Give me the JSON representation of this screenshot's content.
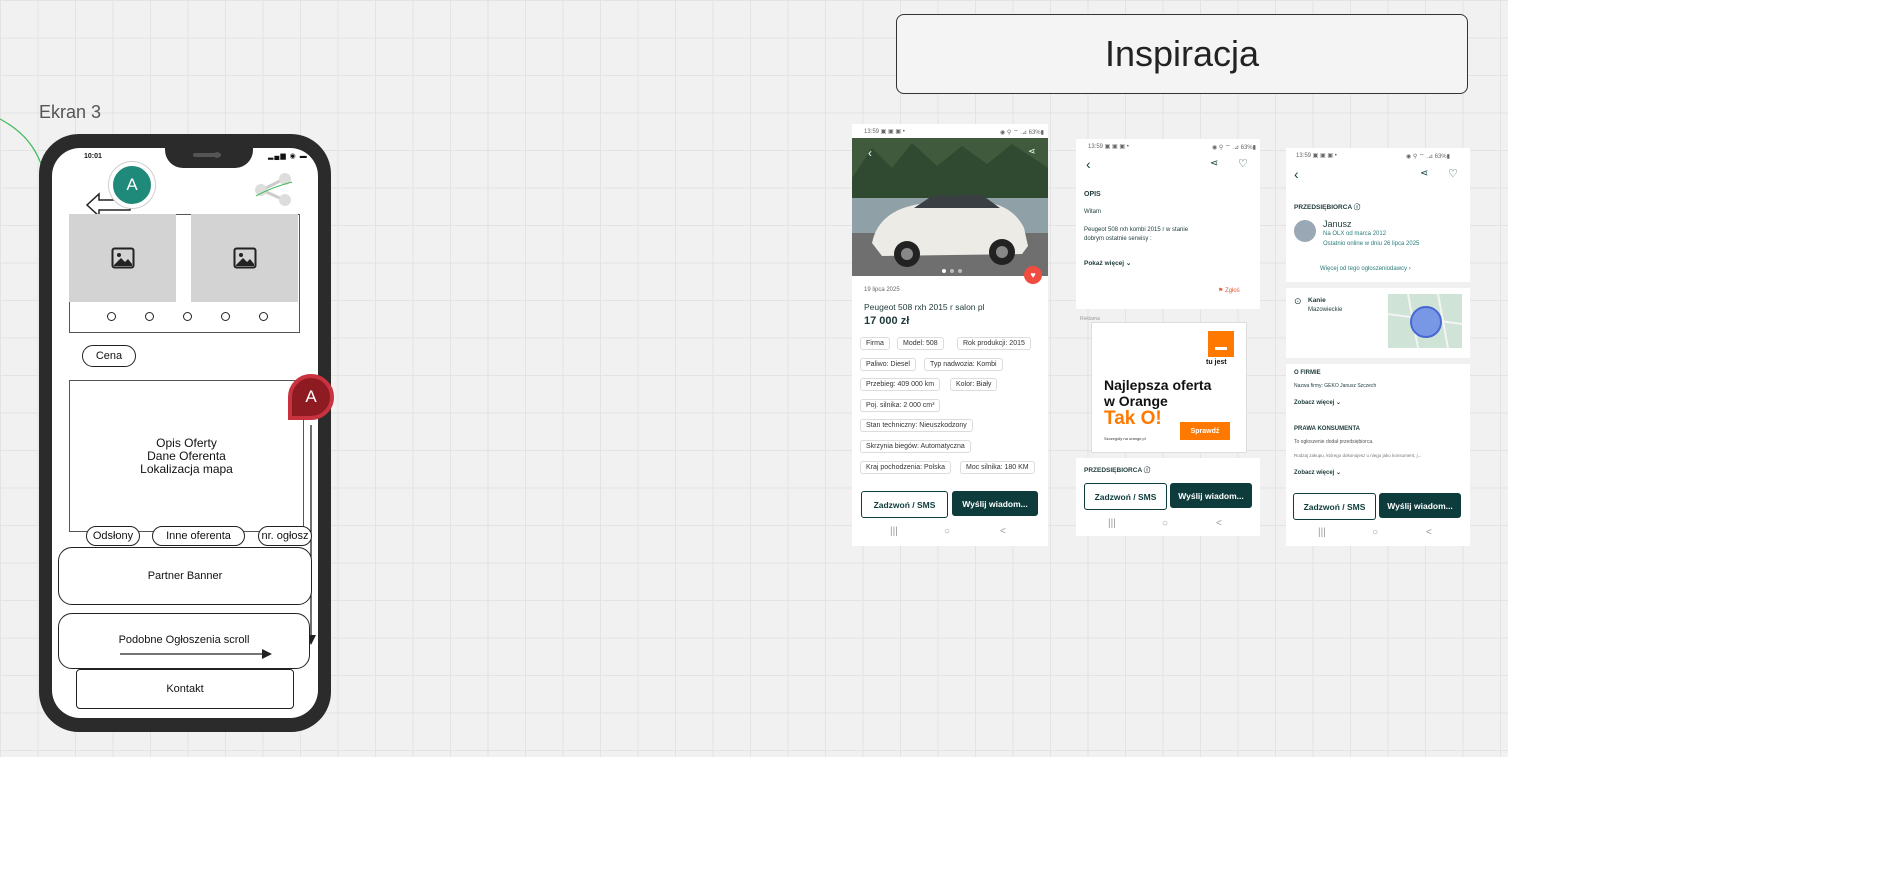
{
  "board": {
    "screen_label": "Ekran 3",
    "inspiration_title": "Inspiracja"
  },
  "wireframe": {
    "status_time": "10:01",
    "status_icons": "▂▄▆ ◉ ▬",
    "back_icon": "arrow-left-icon",
    "share_icon": "share-icon",
    "image_icon": "image-placeholder-icon",
    "badge_green": "A",
    "badge_red": "A",
    "badge_green_color": "#1f8a7a",
    "badge_red_color": "#8e1b22",
    "price_pill": "Cena",
    "content_lines": [
      "Opis Oferty",
      "Dane Oferenta",
      "Lokalizacja mapa"
    ],
    "pills": [
      "Odsłony",
      "Inne oferenta",
      "nr. ogłosz"
    ],
    "partner_banner": "Partner Banner",
    "similar_ads": "Podobne Ogłoszenia scroll",
    "contact": "Kontakt"
  },
  "shot1": {
    "status": "13:59 ▣ ▣ ▣ •",
    "status_right": "◉ ⚲ ⌔ .⊿ 63%▮",
    "date": "19 lipca 2025",
    "title": "Peugeot 508 rxh 2015 r salon pl",
    "price": "17 000 zł",
    "chips": [
      [
        "Firma",
        "Model: 508",
        "Rok produkcji: 2015"
      ],
      [
        "Paliwo: Diesel",
        "Typ nadwozia: Kombi"
      ],
      [
        "Przebieg: 409 000 km",
        "Kolor: Biały"
      ],
      [
        "Poj. silnika: 2 000 cm³"
      ],
      [
        "Stan techniczny: Nieuszkodzony"
      ],
      [
        "Skrzynia biegów: Automatyczna"
      ],
      [
        "Kraj pochodzenia: Polska",
        "Moc silnika: 180 KM"
      ]
    ],
    "call": "Zadzwoń / SMS",
    "message": "Wyślij wiadom..."
  },
  "shot2": {
    "status": "13:59 ▣ ▣ ▣ •",
    "status_right": "◉ ⚲ ⌔ .⊿ 63%▮",
    "section": "OPIS",
    "greeting": "Witam",
    "desc1": "Peugeot 508 rxh kombi 2015 r w stanie",
    "desc2": "dobrym ostatnie serwisy :",
    "more": "Pokaż więcej",
    "report": "Zgłoś",
    "ad_label": "Reklama",
    "ad_brand": "tu jest",
    "ad_line1": "Najlepsza oferta",
    "ad_line2": "w Orange",
    "ad_line3": "Tak O!",
    "ad_small": "Szczegóły na orange.pl",
    "ad_cta": "Sprawdź",
    "seller_section": "PRZEDSIĘBIORCA",
    "call": "Zadzwoń / SMS",
    "message": "Wyślij wiadom..."
  },
  "shot3": {
    "status": "13:59 ▣ ▣ ▣ •",
    "status_right": "◉ ⚲ ⌔ .⊿ 63%▮",
    "seller_section": "PRZEDSIĘBIORCA",
    "seller_name": "Janusz",
    "since": "Na OLX od marca 2012",
    "online": "Ostatnio online w dniu 26 lipca 2025",
    "more_ads": "Więcej od tego ogłoszeniodawcy",
    "city": "Kanie",
    "region": "Mazowieckie",
    "company_section": "O FIRMIE",
    "company_name": "Nazwa firmy: GEKO Janusz Szczech",
    "see_more1": "Zobacz więcej",
    "consumer_section": "PRAWA KONSUMENTA",
    "consumer_text1": "To ogłoszenie dodał przedsiębiorca.",
    "consumer_text2": "Rodzaj zakupu, którego dokonujesz u niego jako konsument, j...",
    "see_more2": "Zobacz więcej",
    "call": "Zadzwoń / SMS",
    "message": "Wyślij wiadom..."
  },
  "android_nav": [
    "|||",
    "○",
    "<"
  ]
}
